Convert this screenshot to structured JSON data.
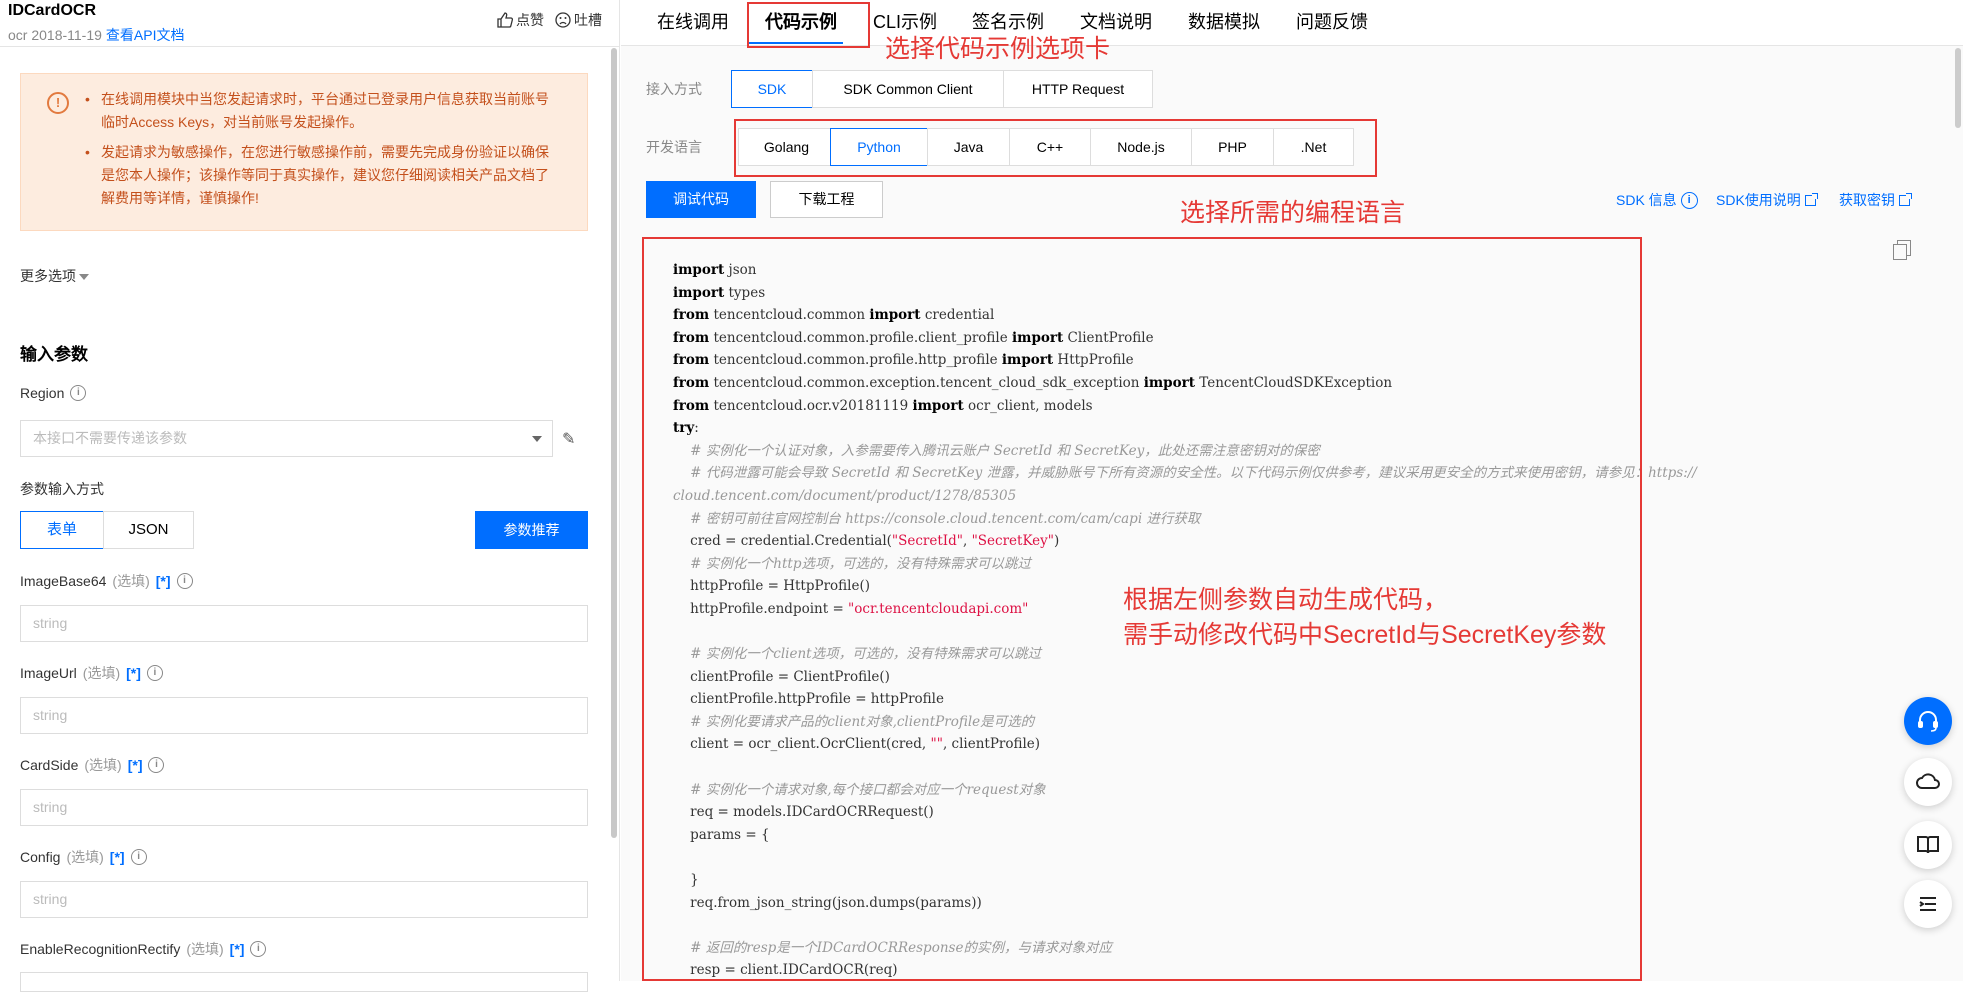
{
  "header": {
    "api_name": "IDCardOCR",
    "api_meta": "ocr 2018-11-19",
    "api_doc_link": "查看API文档",
    "like_label": "点赞",
    "complain_label": "吐槽"
  },
  "warning": {
    "items": [
      "在线调用模块中当您发起请求时，平台通过已登录用户信息获取当前账号临时Access Keys，对当前账号发起操作。",
      "发起请求为敏感操作，在您进行敏感操作前，需要先完成身份验证以确保是您本人操作；该操作等同于真实操作，建议您仔细阅读相关产品文档了解费用等详情，谨慎操作!"
    ]
  },
  "more_options": "更多选项",
  "input_params": {
    "title": "输入参数",
    "region_label": "Region",
    "region_placeholder": "本接口不需要传递该参数",
    "input_mode_label": "参数输入方式",
    "mode_form": "表单",
    "mode_json": "JSON",
    "recommend_btn": "参数推荐",
    "optional": "(选填)",
    "star": "[*]",
    "string_placeholder": "string",
    "fields": [
      "ImageBase64",
      "ImageUrl",
      "CardSide",
      "Config",
      "EnableRecognitionRectify"
    ]
  },
  "tabs": [
    "在线调用",
    "代码示例",
    "CLI示例",
    "签名示例",
    "文档说明",
    "数据模拟",
    "问题反馈"
  ],
  "active_tab": "代码示例",
  "access": {
    "label": "接入方式",
    "options": [
      "SDK",
      "SDK Common Client",
      "HTTP Request"
    ],
    "selected": "SDK"
  },
  "language": {
    "label": "开发语言",
    "options": [
      "Golang",
      "Python",
      "Java",
      "C++",
      "Node.js",
      "PHP",
      ".Net"
    ],
    "selected": "Python"
  },
  "actions": {
    "debug": "调试代码",
    "download": "下载工程",
    "sdk_info": "SDK 信息",
    "sdk_usage": "SDK使用说明",
    "get_key": "获取密钥"
  },
  "annotations": {
    "tab_hint": "选择代码示例选项卡",
    "lang_hint": "选择所需的编程语言",
    "code_hint_1": "根据左侧参数自动生成代码，",
    "code_hint_2": "需手动修改代码中SecretId与SecretKey参数"
  },
  "code_lines": [
    [
      [
        "kw",
        "import"
      ],
      [
        "t",
        " json"
      ]
    ],
    [
      [
        "kw",
        "import"
      ],
      [
        "t",
        " types"
      ]
    ],
    [
      [
        "kw",
        "from"
      ],
      [
        "t",
        " tencentcloud.common "
      ],
      [
        "kw",
        "import"
      ],
      [
        "t",
        " credential"
      ]
    ],
    [
      [
        "kw",
        "from"
      ],
      [
        "t",
        " tencentcloud.common.profile.client_profile "
      ],
      [
        "kw",
        "import"
      ],
      [
        "t",
        " ClientProfile"
      ]
    ],
    [
      [
        "kw",
        "from"
      ],
      [
        "t",
        " tencentcloud.common.profile.http_profile "
      ],
      [
        "kw",
        "import"
      ],
      [
        "t",
        " HttpProfile"
      ]
    ],
    [
      [
        "kw",
        "from"
      ],
      [
        "t",
        " tencentcloud.common.exception.tencent_cloud_sdk_exception "
      ],
      [
        "kw",
        "import"
      ],
      [
        "t",
        " TencentCloudSDKException"
      ]
    ],
    [
      [
        "kw",
        "from"
      ],
      [
        "t",
        " tencentcloud.ocr.v20181119 "
      ],
      [
        "kw",
        "import"
      ],
      [
        "t",
        " ocr_client, models"
      ]
    ],
    [
      [
        "kw",
        "try"
      ],
      [
        "t",
        ":"
      ]
    ],
    [
      [
        "t",
        "    "
      ],
      [
        "cm",
        "# 实例化一个认证对象，入参需要传入腾讯云账户 SecretId 和 SecretKey，此处还需注意密钥对的保密"
      ]
    ],
    [
      [
        "t",
        "    "
      ],
      [
        "cm",
        "# 代码泄露可能会导致 SecretId 和 SecretKey 泄露，并威胁账号下所有资源的安全性。以下代码示例仅供参考，建议采用更安全的方式来使用密钥，请参见：https://"
      ]
    ],
    [
      [
        "cm",
        "cloud.tencent.com/document/product/1278/85305"
      ]
    ],
    [
      [
        "t",
        "    "
      ],
      [
        "cm",
        "# 密钥可前往官网控制台 https://console.cloud.tencent.com/cam/capi 进行获取"
      ]
    ],
    [
      [
        "t",
        "    cred = credential.Credential("
      ],
      [
        "st",
        "\"SecretId\""
      ],
      [
        "t",
        ", "
      ],
      [
        "st",
        "\"SecretKey\""
      ],
      [
        "t",
        ")"
      ]
    ],
    [
      [
        "t",
        "    "
      ],
      [
        "cm",
        "# 实例化一个http选项，可选的，没有特殊需求可以跳过"
      ]
    ],
    [
      [
        "t",
        "    httpProfile = HttpProfile()"
      ]
    ],
    [
      [
        "t",
        "    httpProfile.endpoint = "
      ],
      [
        "st",
        "\"ocr.tencentcloudapi.com\""
      ]
    ],
    [
      [
        "t",
        ""
      ]
    ],
    [
      [
        "t",
        "    "
      ],
      [
        "cm",
        "# 实例化一个client选项，可选的，没有特殊需求可以跳过"
      ]
    ],
    [
      [
        "t",
        "    clientProfile = ClientProfile()"
      ]
    ],
    [
      [
        "t",
        "    clientProfile.httpProfile = httpProfile"
      ]
    ],
    [
      [
        "t",
        "    "
      ],
      [
        "cm",
        "# 实例化要请求产品的client对象,clientProfile是可选的"
      ]
    ],
    [
      [
        "t",
        "    client = ocr_client.OcrClient(cred, "
      ],
      [
        "st",
        "\"\""
      ],
      [
        "t",
        ", clientProfile)"
      ]
    ],
    [
      [
        "t",
        ""
      ]
    ],
    [
      [
        "t",
        "    "
      ],
      [
        "cm",
        "# 实例化一个请求对象,每个接口都会对应一个request对象"
      ]
    ],
    [
      [
        "t",
        "    req = models.IDCardOCRRequest()"
      ]
    ],
    [
      [
        "t",
        "    params = {"
      ]
    ],
    [
      [
        "t",
        ""
      ]
    ],
    [
      [
        "t",
        "    }"
      ]
    ],
    [
      [
        "t",
        "    req.from_json_string(json.dumps(params))"
      ]
    ],
    [
      [
        "t",
        ""
      ]
    ],
    [
      [
        "t",
        "    "
      ],
      [
        "cm",
        "# 返回的resp是一个IDCardOCRResponse的实例，与请求对象对应"
      ]
    ],
    [
      [
        "t",
        "    resp = client.IDCardOCR(req)"
      ]
    ]
  ],
  "colors": {
    "accent": "#006eff",
    "annotation": "#e53935",
    "warning_bg": "#fdecdf",
    "warning_text": "#c4501c"
  },
  "icons": [
    "thumbs-up-icon",
    "frown-icon",
    "warning-icon",
    "info-icon",
    "pencil-icon",
    "copy-icon",
    "external-link-icon",
    "headset-icon",
    "cloud-icon",
    "book-icon",
    "menu-icon"
  ]
}
